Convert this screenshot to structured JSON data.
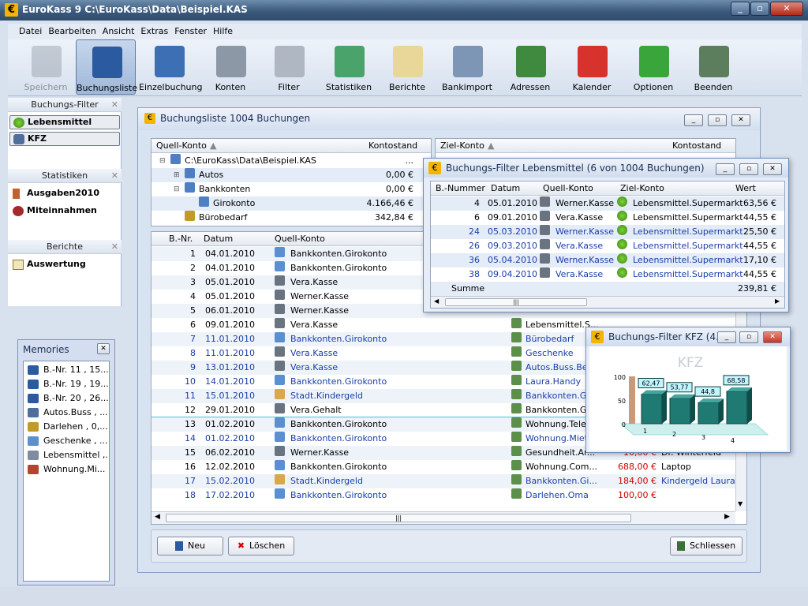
{
  "window": {
    "title": "EuroKass 9  C:\\EuroKass\\Data\\Beispiel.KAS",
    "logo": "€"
  },
  "menu": [
    "Datei",
    "Bearbeiten",
    "Ansicht",
    "Extras",
    "Fenster",
    "Hilfe"
  ],
  "toolbar": [
    {
      "label": "Speichern",
      "icon": "floppy-icon",
      "disabled": true
    },
    {
      "label": "Buchungsliste",
      "icon": "book-icon",
      "selected": true
    },
    {
      "label": "Einzelbuchung",
      "icon": "book-search-icon"
    },
    {
      "label": "Konten",
      "icon": "database-icon"
    },
    {
      "label": "Filter",
      "icon": "funnel-icon"
    },
    {
      "label": "Statistiken",
      "icon": "chart-icon"
    },
    {
      "label": "Berichte",
      "icon": "report-icon"
    },
    {
      "label": "Bankimport",
      "icon": "bank-icon"
    },
    {
      "label": "Adressen",
      "icon": "people-icon"
    },
    {
      "label": "Kalender",
      "icon": "calendar-icon"
    },
    {
      "label": "Optionen",
      "icon": "checkmark-icon"
    },
    {
      "label": "Beenden",
      "icon": "exit-door-icon"
    }
  ],
  "left": {
    "filter_head": "Buchungs-Filter",
    "filters": [
      "Lebensmittel",
      "KFZ"
    ],
    "stats_head": "Statistiken",
    "stats": [
      "Ausgaben2010",
      "Miteinnahmen"
    ],
    "reports_head": "Berichte",
    "reports": [
      "Auswertung"
    ]
  },
  "memories": {
    "title": "Memories",
    "items": [
      "B.-Nr. 11 , 15....",
      "B.-Nr. 19 , 19....",
      "B.-Nr. 20 , 26....",
      "Autos.Buss , ...",
      "Darlehen , 0,...",
      "Geschenke , ...",
      "Lebensmittel ,...",
      "Wohnung.Mi..."
    ]
  },
  "booklist": {
    "title": "Buchungsliste  1004 Buchungen",
    "tree_head": {
      "col1": "Quell-Konto",
      "col2": "Kontostand"
    },
    "tree2_head": {
      "col1": "Ziel-Konto",
      "col2": "Kontostand"
    },
    "tree": [
      {
        "name": "C:\\EuroKass\\Data\\Beispiel.KAS",
        "value": "...",
        "indent": 0
      },
      {
        "name": "Autos",
        "value": "0,00 €",
        "indent": 1
      },
      {
        "name": "Bankkonten",
        "value": "0,00 €",
        "indent": 1
      },
      {
        "name": "Girokonto",
        "value": "4.166,46 €",
        "indent": 2
      },
      {
        "name": "Bürobedarf",
        "value": "342,84 €",
        "indent": 1
      }
    ],
    "cols": {
      "nr": "B.-Nr.",
      "datum": "Datum",
      "quell": "Quell-Konto"
    },
    "rows": [
      {
        "nr": "1",
        "date": "04.01.2010",
        "src": "Bankkonten.Girokonto",
        "dst": "",
        "amt": "",
        "note": "",
        "blue": false
      },
      {
        "nr": "2",
        "date": "04.01.2010",
        "src": "Bankkonten.Girokonto",
        "dst": "",
        "amt": "",
        "note": "",
        "blue": false
      },
      {
        "nr": "3",
        "date": "05.01.2010",
        "src": "Vera.Kasse",
        "dst": "",
        "amt": "",
        "note": "",
        "blue": false
      },
      {
        "nr": "4",
        "date": "05.01.2010",
        "src": "Werner.Kasse",
        "dst": "",
        "amt": "",
        "note": "",
        "blue": false
      },
      {
        "nr": "5",
        "date": "06.01.2010",
        "src": "Werner.Kasse",
        "dst": "",
        "amt": "",
        "note": "",
        "blue": false
      },
      {
        "nr": "6",
        "date": "09.01.2010",
        "src": "Vera.Kasse",
        "dst": "Lebensmittel.S...",
        "amt": "",
        "note": "",
        "blue": false
      },
      {
        "nr": "7",
        "date": "11.01.2010",
        "src": "Bankkonten.Girokonto",
        "dst": "Bürobedarf",
        "amt": "",
        "note": "",
        "blue": true
      },
      {
        "nr": "8",
        "date": "11.01.2010",
        "src": "Vera.Kasse",
        "dst": "Geschenke",
        "amt": "",
        "note": "",
        "blue": true
      },
      {
        "nr": "9",
        "date": "13.01.2010",
        "src": "Vera.Kasse",
        "dst": "Autos.Buss.Be...",
        "amt": "",
        "note": "",
        "blue": true
      },
      {
        "nr": "10",
        "date": "14.01.2010",
        "src": "Bankkonten.Girokonto",
        "dst": "Laura.Handy",
        "amt": "",
        "note": "",
        "blue": true
      },
      {
        "nr": "11",
        "date": "15.01.2010",
        "src": "Stadt.Kindergeld",
        "dst": "Bankkonten.Gi...",
        "amt": "",
        "note": "",
        "blue": true
      },
      {
        "nr": "12",
        "date": "29.01.2010",
        "src": "Vera.Gehalt",
        "dst": "Bankkonten.Gi...",
        "amt": "",
        "note": "",
        "blue": false
      },
      {
        "nr": "13",
        "date": "01.02.2010",
        "src": "Bankkonten.Girokonto",
        "dst": "Wohnung.Tele...",
        "amt": "",
        "note": "",
        "blue": false
      },
      {
        "nr": "14",
        "date": "01.02.2010",
        "src": "Bankkonten.Girokonto",
        "dst": "Wohnung.Miete",
        "amt": "",
        "note": "",
        "blue": true
      },
      {
        "nr": "15",
        "date": "06.02.2010",
        "src": "Werner.Kasse",
        "dst": "Gesundheit.Ar...",
        "amt": "10,00 €",
        "note": "Dr. Winterfeld",
        "blue": false
      },
      {
        "nr": "16",
        "date": "12.02.2010",
        "src": "Bankkonten.Girokonto",
        "dst": "Wohnung.Com...",
        "amt": "688,00 €",
        "note": "Laptop",
        "blue": false
      },
      {
        "nr": "17",
        "date": "15.02.2010",
        "src": "Stadt.Kindergeld",
        "dst": "Bankkonten.Gi...",
        "amt": "184,00 €",
        "note": "Kindergeld Laura",
        "blue": true
      },
      {
        "nr": "18",
        "date": "17.02.2010",
        "src": "Bankkonten.Girokonto",
        "dst": "Darlehen.Oma",
        "amt": "100,00 €",
        "note": "",
        "blue": true
      }
    ],
    "btn_new": "Neu",
    "btn_delete": "Löschen",
    "btn_close": "Schliessen"
  },
  "lebensmittel": {
    "title": "Buchungs-Filter Lebensmittel (6 von 1004 Buchungen)",
    "cols": [
      "B.-Nummer",
      "Datum",
      "Quell-Konto",
      "Ziel-Konto",
      "Wert"
    ],
    "rows": [
      {
        "nr": "4",
        "date": "05.01.2010",
        "src": "Werner.Kasse",
        "dst": "Lebensmittel.Supermarkt",
        "val": "63,56 €",
        "blue": false
      },
      {
        "nr": "6",
        "date": "09.01.2010",
        "src": "Vera.Kasse",
        "dst": "Lebensmittel.Supermarkt",
        "val": "44,55 €",
        "blue": false
      },
      {
        "nr": "24",
        "date": "05.03.2010",
        "src": "Werner.Kasse",
        "dst": "Lebensmittel.Supermarkt",
        "val": "25,50 €",
        "blue": true
      },
      {
        "nr": "26",
        "date": "09.03.2010",
        "src": "Vera.Kasse",
        "dst": "Lebensmittel.Supermarkt",
        "val": "44,55 €",
        "blue": true
      },
      {
        "nr": "36",
        "date": "05.04.2010",
        "src": "Werner.Kasse",
        "dst": "Lebensmittel.Supermarkt",
        "val": "17,10 €",
        "blue": true
      },
      {
        "nr": "38",
        "date": "09.04.2010",
        "src": "Vera.Kasse",
        "dst": "Lebensmittel.Supermarkt",
        "val": "44,55 €",
        "blue": true
      }
    ],
    "sum_label": "Summe",
    "sum": "239,81 €"
  },
  "kfz": {
    "title": "Buchungs-Filter KFZ (4...",
    "chart_title": "KFZ",
    "yticks": [
      "100",
      "50",
      "0"
    ],
    "bars": [
      {
        "cat": "1",
        "value": 62.47,
        "label": "62,47"
      },
      {
        "cat": "2",
        "value": 53.77,
        "label": "53,77"
      },
      {
        "cat": "3",
        "value": 44.8,
        "label": "44,8"
      },
      {
        "cat": "4",
        "value": 68.58,
        "label": "68,58"
      }
    ]
  },
  "chart_data": {
    "type": "bar",
    "title": "KFZ",
    "categories": [
      "1",
      "2",
      "3",
      "4"
    ],
    "values": [
      62.47,
      53.77,
      44.8,
      68.58
    ],
    "ylim": [
      0,
      100
    ]
  }
}
